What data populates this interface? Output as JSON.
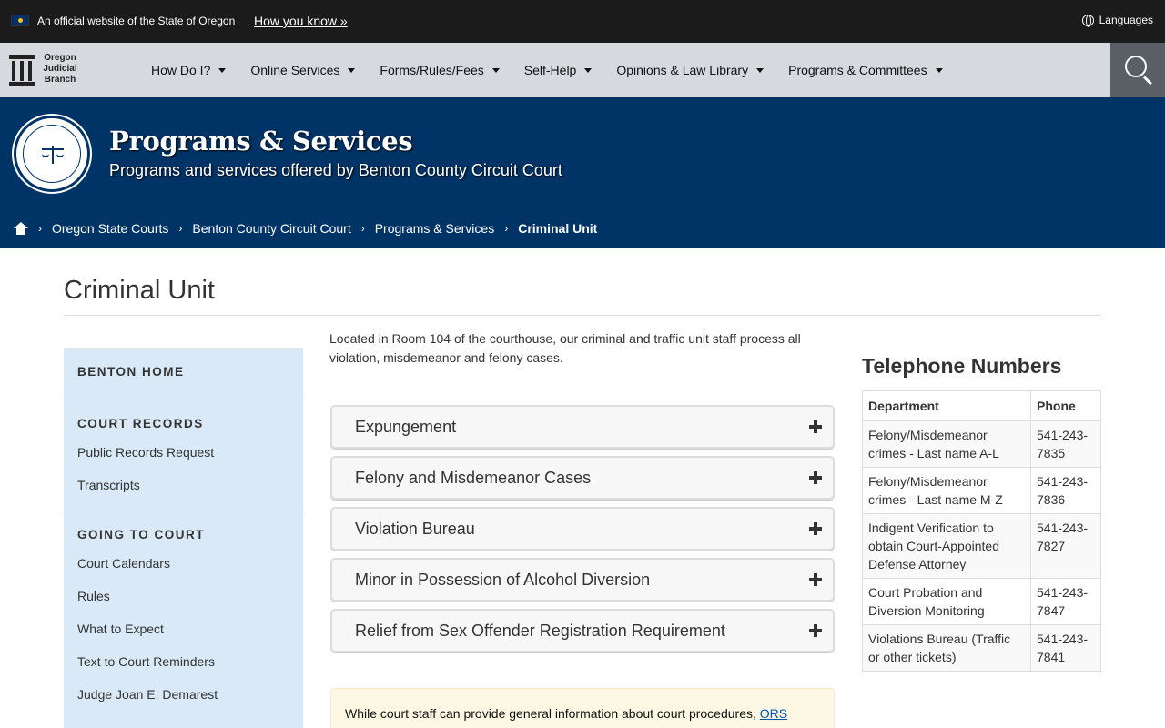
{
  "official_bar": {
    "text": "An official website of the State of Oregon",
    "how_link": "How you know »",
    "languages": "Languages"
  },
  "logo": {
    "line1": "Oregon",
    "line2": "Judicial",
    "line3": "Branch"
  },
  "nav": {
    "items": [
      {
        "label": "How Do I?"
      },
      {
        "label": "Online Services"
      },
      {
        "label": "Forms/Rules/Fees"
      },
      {
        "label": "Self-Help"
      },
      {
        "label": "Opinions & Law Library"
      },
      {
        "label": "Programs & Committees"
      }
    ]
  },
  "hero": {
    "title": "Programs & Services",
    "subtitle": "Programs and services offered by Benton County Circuit Court"
  },
  "breadcrumb": {
    "items": [
      "Oregon State Courts",
      "Benton County Circuit Court",
      "Programs & Services"
    ],
    "current": "Criminal Unit"
  },
  "page": {
    "title": "Criminal Unit",
    "intro": "Located in Room 104 of the courthouse, our criminal and traffic unit staff process all violation, misdemeanor and felony cases."
  },
  "sidebar": {
    "home": "BENTON HOME",
    "records_heading": "COURT RECORDS",
    "records_links": [
      "Public Records Request",
      "Transcripts"
    ],
    "going_heading": "GOING TO COURT",
    "going_links": [
      "Court Calendars",
      "Rules",
      "What to Expect",
      "Text to Court Reminders",
      "Judge Joan E. Demarest"
    ]
  },
  "accordion": [
    "Expungement",
    "Felony and Misdemeanor Cases",
    "Violation Bureau",
    "Minor in Possession of Alcohol Diversion",
    "Relief from Sex Offender Registration Requirement"
  ],
  "notice": {
    "text": "While court staff can provide general information about court procedures, ",
    "link": "ORS"
  },
  "phones": {
    "title": "Telephone Numbers",
    "headers": [
      "Department",
      "Phone"
    ],
    "rows": [
      [
        "Felony/Misdemeanor crimes - Last name A-L",
        "541-243-7835"
      ],
      [
        "Felony/Misdemeanor crimes - Last name M-Z",
        "541-243-7836"
      ],
      [
        "Indigent Verification to obtain Court-Appointed Defense Attorney",
        "541-243-7827"
      ],
      [
        "Court Probation and Diversion Monitoring",
        "541-243-7847"
      ],
      [
        "Violations Bureau (Traffic or other tickets)",
        "541-243-7841"
      ]
    ]
  },
  "colors": {
    "hero_bg": "#003366",
    "nav_bg": "#d6dadf",
    "sidebar_bg": "#d9e9f8",
    "top_bar": "#1b1b1b"
  }
}
